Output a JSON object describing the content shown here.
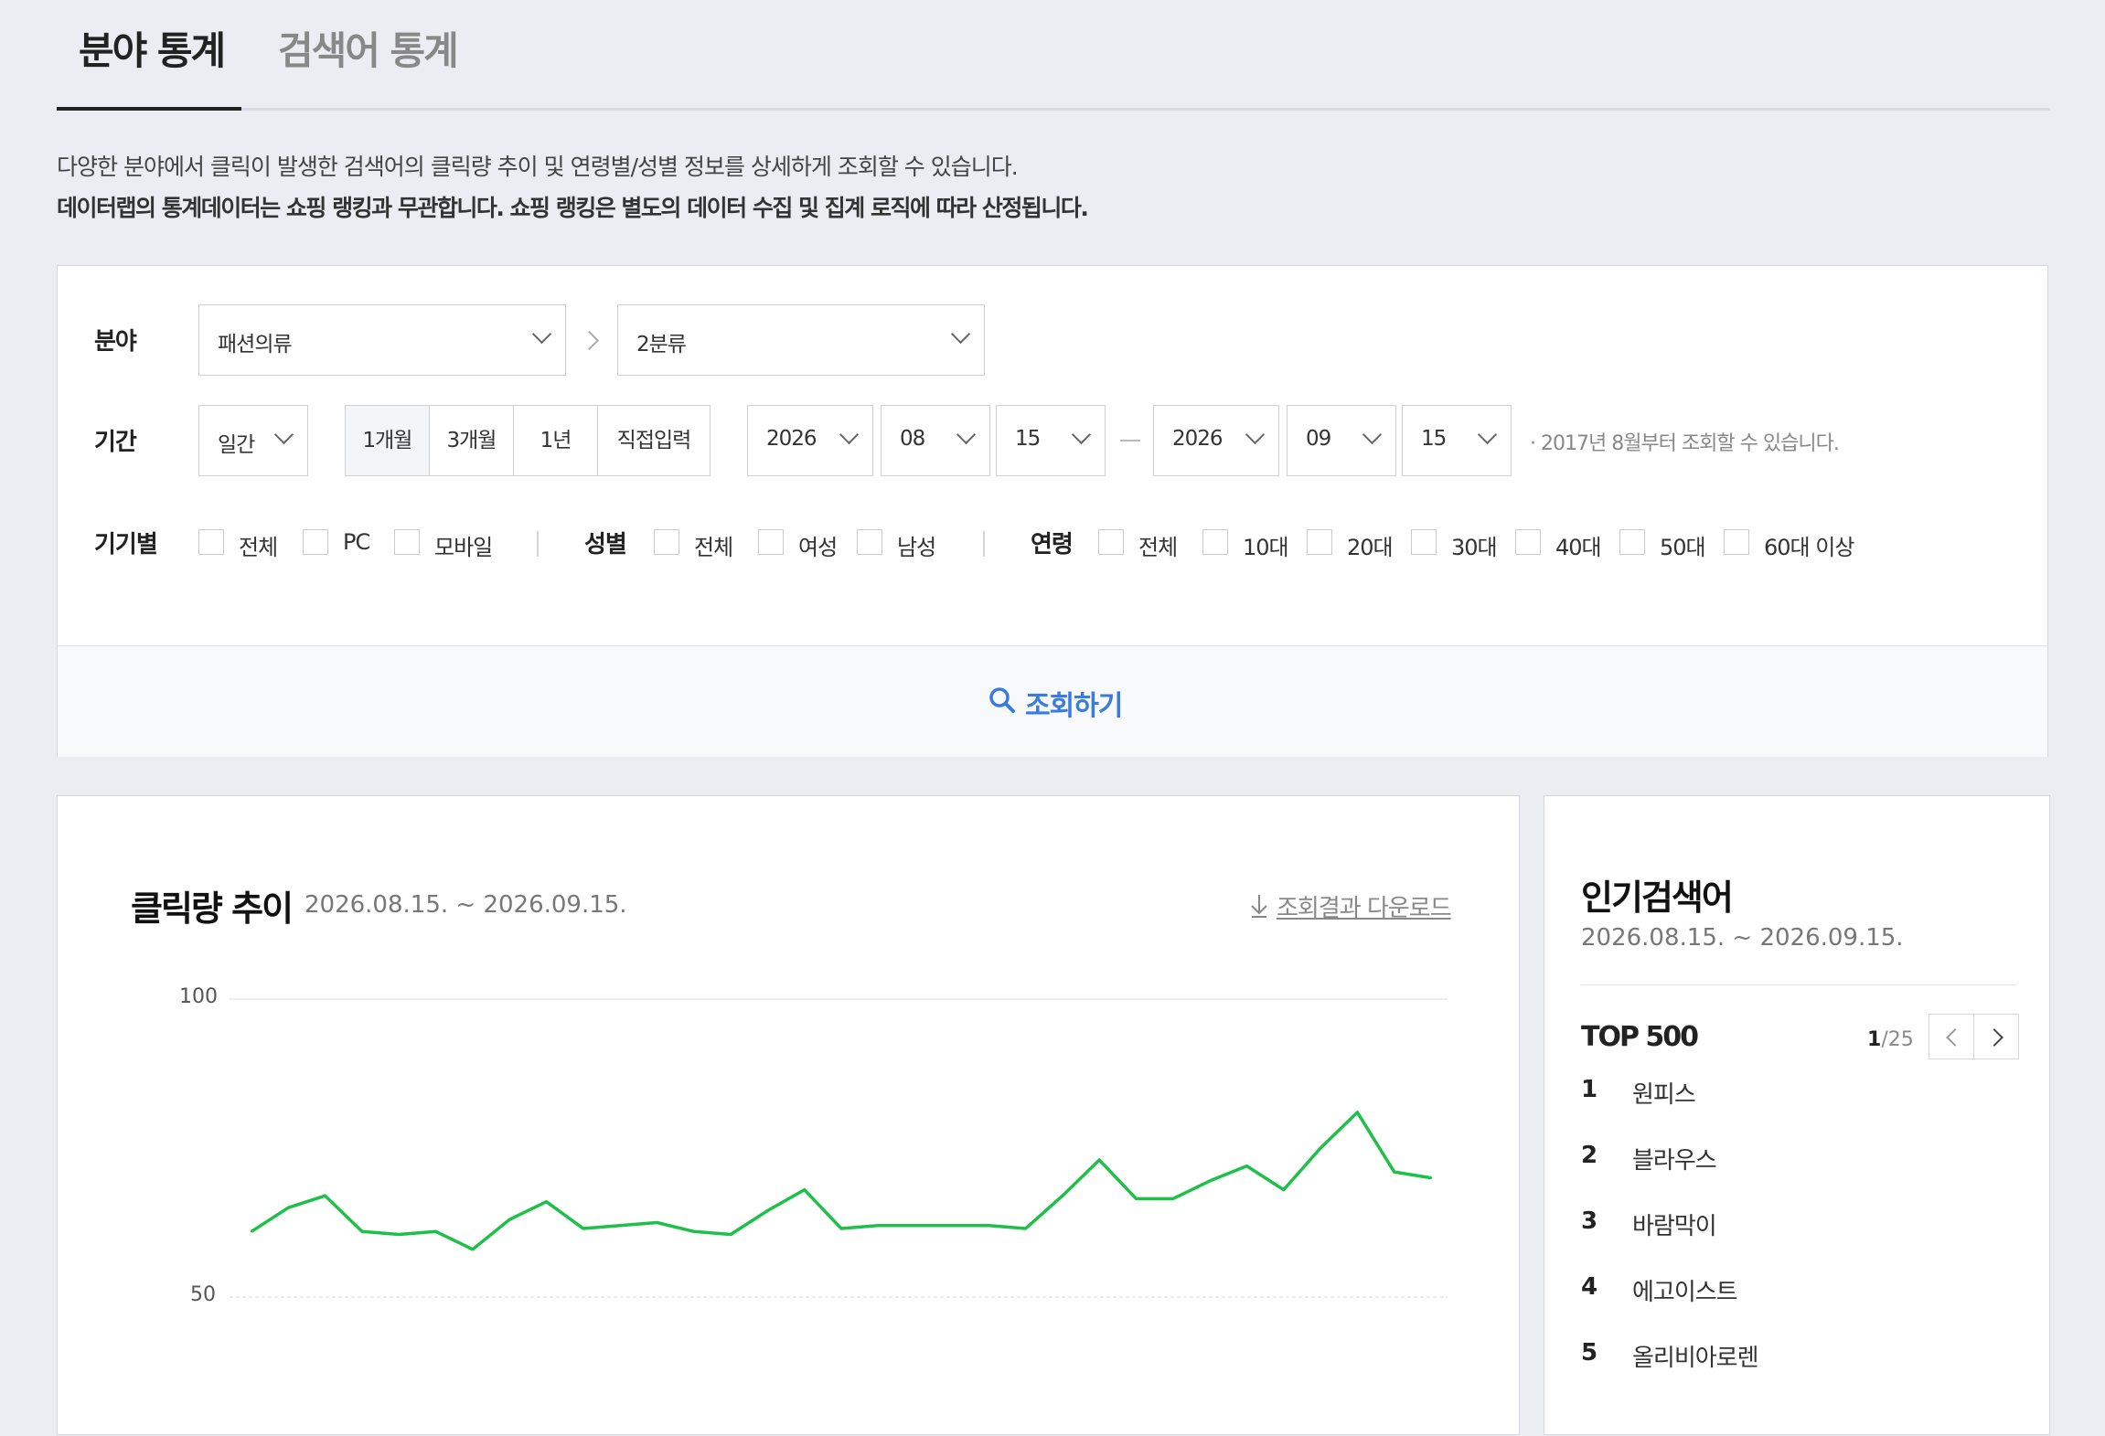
{
  "tabs": [
    {
      "label": "분야 통계",
      "active": true
    },
    {
      "label": "검색어 통계",
      "active": false
    }
  ],
  "description": {
    "line1": "다양한 분야에서 클릭이 발생한 검색어의 클릭량 추이 및 연령별/성별 정보를 상세하게 조회할 수 있습니다.",
    "line2": "데이터랩의 통계데이터는 쇼핑 랭킹과 무관합니다. 쇼핑 랭킹은 별도의 데이터 수집 및 집계 로직에 따라 산정됩니다."
  },
  "filters": {
    "category": {
      "label": "분야",
      "level1": "패션의류",
      "level2": "2분류"
    },
    "period": {
      "label": "기간",
      "unit": "일간",
      "presets": [
        "1개월",
        "3개월",
        "1년",
        "직접입력"
      ],
      "active_preset": "1개월",
      "start": {
        "year": "2026",
        "month": "08",
        "day": "15"
      },
      "end": {
        "year": "2026",
        "month": "09",
        "day": "15"
      },
      "note": "· 2017년 8월부터 조회할 수 있습니다."
    },
    "device": {
      "label": "기기별",
      "options": [
        "전체",
        "PC",
        "모바일"
      ]
    },
    "gender": {
      "label": "성별",
      "options": [
        "전체",
        "여성",
        "남성"
      ]
    },
    "age": {
      "label": "연령",
      "options": [
        "전체",
        "10대",
        "20대",
        "30대",
        "40대",
        "50대",
        "60대 이상"
      ]
    }
  },
  "search_button": {
    "label": "조회하기",
    "icon": "search-icon",
    "color": "#3a7be0"
  },
  "chart_panel": {
    "title": "클릭량 추이",
    "range": "2026.08.15. ~ 2026.09.15.",
    "download_label": "조회결과 다운로드"
  },
  "chart_data": {
    "type": "line",
    "ylim": [
      50,
      100
    ],
    "y_ticks": [
      "100",
      "50"
    ],
    "grid": true,
    "series": [
      {
        "color": "#1ec04a",
        "values": [
          61,
          65,
          67,
          61,
          60.5,
          61,
          58,
          63,
          66,
          61.5,
          62,
          62.5,
          61,
          60.5,
          64.5,
          68,
          61.5,
          62,
          62,
          62,
          62,
          61.5,
          67,
          73,
          66.5,
          66.5,
          69.5,
          72,
          68,
          75,
          81,
          71,
          70
        ]
      }
    ]
  },
  "ranking": {
    "title": "인기검색어",
    "range": "2026.08.15. ~ 2026.09.15.",
    "top_label": "TOP 500",
    "page_current": "1",
    "page_total": "/25",
    "items": [
      {
        "rank": "1",
        "name": "원피스"
      },
      {
        "rank": "2",
        "name": "블라우스"
      },
      {
        "rank": "3",
        "name": "바람막이"
      },
      {
        "rank": "4",
        "name": "에고이스트"
      },
      {
        "rank": "5",
        "name": "올리비아로렌"
      }
    ]
  }
}
